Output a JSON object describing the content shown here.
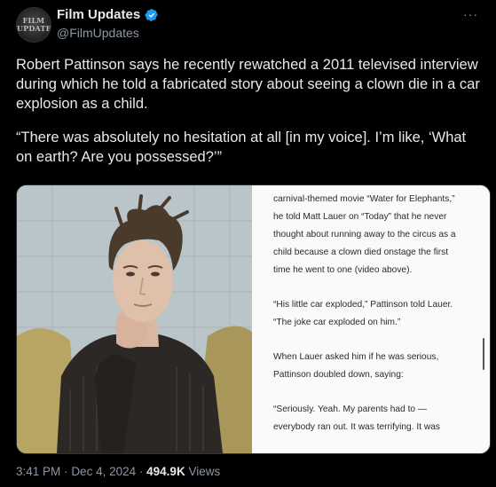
{
  "header": {
    "avatar_logo_text": "FILM UPDATES",
    "display_name": "Film Updates",
    "handle": "@FilmUpdates",
    "more_label": "···",
    "verified_icon": "verified-badge-icon",
    "verified_color": "#1d9bf0"
  },
  "tweet": {
    "paragraph_1": "Robert Pattinson says he recently rewatched a 2011 televised interview during which he told a fabricated story about seeing a clown die in a car explosion as a child.",
    "paragraph_2": "“There was absolutely no hesitation at all [in my voice]. I’m like, ‘What on earth? Are you possessed?’”"
  },
  "article": {
    "p1": "carnival-themed movie “Water for Elephants,” he told Matt Lauer on “Today” that he never thought about running away to the circus as a child because a clown died onstage the first time he went to one (video above).",
    "p2": "“His little car exploded,” Pattinson told Lauer. “The joke car exploded on him.”",
    "p3": "When Lauer asked him if he was serious, Pattinson doubled down, saying:",
    "p4": "“Seriously. Yeah. My parents had to — everybody ran out. It was terrifying. It was"
  },
  "meta": {
    "time": "3:41 PM",
    "separator": "·",
    "date": "Dec 4, 2024",
    "views_count": "494.9K",
    "views_label": "Views"
  }
}
